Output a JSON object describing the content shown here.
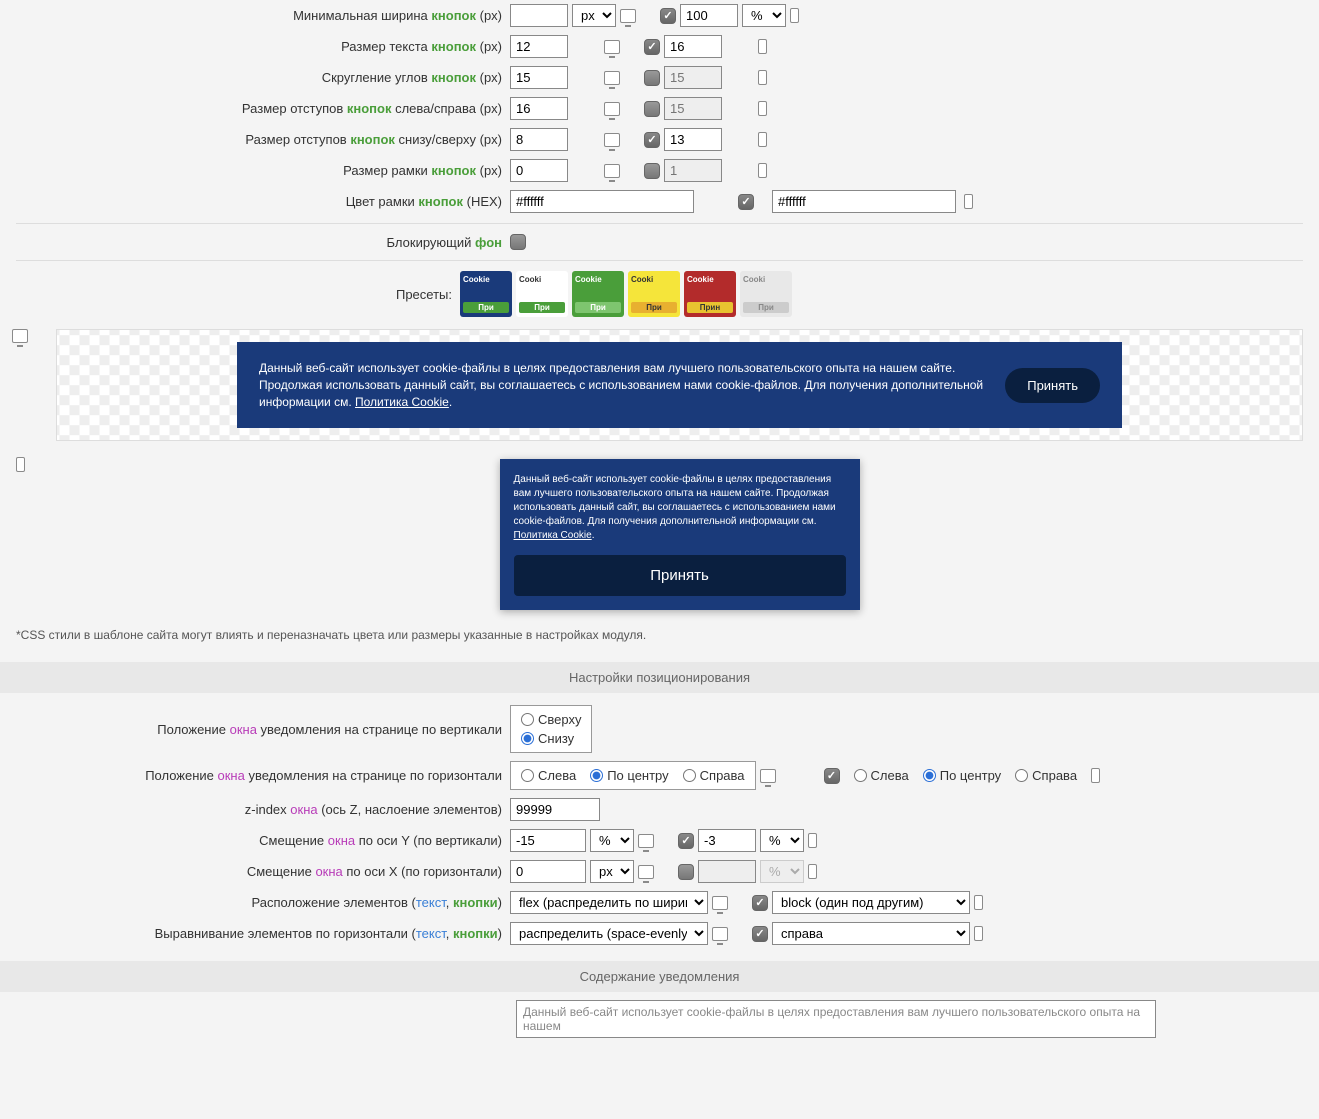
{
  "rows": {
    "min_width": {
      "label_pre": "Минимальная ширина ",
      "kw": "кнопок",
      "label_post": " (px)",
      "d_val": "",
      "d_unit": "px",
      "m_checked": true,
      "m_val": "100",
      "m_unit": "%"
    },
    "text_size": {
      "label_pre": "Размер текста ",
      "kw": "кнопок",
      "label_post": " (px)",
      "d_val": "12",
      "m_checked": true,
      "m_val": "16"
    },
    "border_radius": {
      "label_pre": "Скругление углов ",
      "kw": "кнопок",
      "label_post": " (px)",
      "d_val": "15",
      "m_checked": false,
      "m_placeholder": "15"
    },
    "pad_lr": {
      "label_pre": "Размер отступов ",
      "kw": "кнопок",
      "label_post": " слева/справа (px)",
      "d_val": "16",
      "m_checked": false,
      "m_placeholder": "15"
    },
    "pad_tb": {
      "label_pre": "Размер отступов ",
      "kw": "кнопок",
      "label_post": " снизу/сверху (px)",
      "d_val": "8",
      "m_checked": true,
      "m_val": "13"
    },
    "border_size": {
      "label_pre": "Размер рамки ",
      "kw": "кнопок",
      "label_post": " (px)",
      "d_val": "0",
      "m_checked": false,
      "m_placeholder": "1"
    },
    "border_color": {
      "label_pre": "Цвет рамки ",
      "kw": "кнопок",
      "label_post": " (HEX)",
      "d_val": "#ffffff",
      "m_checked": true,
      "m_val": "#ffffff"
    },
    "blocking_bg": {
      "label": "Блокирующий ",
      "kw": "фон",
      "checked": false
    }
  },
  "presets": {
    "label": "Пресеты:",
    "items": [
      {
        "bg": "#1a3a7a",
        "txt": "#fff",
        "btn_bg": "#4a9e3a",
        "btn_txt": "#fff",
        "cookie": "Cookie",
        "accept": "При"
      },
      {
        "bg": "#fff",
        "txt": "#333",
        "btn_bg": "#4a9e3a",
        "btn_txt": "#fff",
        "cookie": "Cooki",
        "accept": "При"
      },
      {
        "bg": "#4a9e3a",
        "txt": "#fff",
        "btn_bg": "#7ec56f",
        "btn_txt": "#fff",
        "cookie": "Cookie",
        "accept": "При"
      },
      {
        "bg": "#f5e53a",
        "txt": "#333",
        "btn_bg": "#e8b030",
        "btn_txt": "#333",
        "cookie": "Cooki",
        "accept": "При"
      },
      {
        "bg": "#b32b2b",
        "txt": "#fff",
        "btn_bg": "#e8c230",
        "btn_txt": "#333",
        "cookie": "Cookie",
        "accept": "Прин"
      },
      {
        "bg": "#e8e8e8",
        "txt": "#888",
        "btn_bg": "#ccc",
        "btn_txt": "#888",
        "cookie": "Cooki",
        "accept": "При"
      }
    ]
  },
  "preview": {
    "text": "Данный веб-сайт использует cookie-файлы в целях предоставления вам лучшего пользовательского опыта на нашем сайте. Продолжая использовать данный сайт, вы соглашаетесь с использованием нами cookie-файлов. Для получения дополнительной информации см. ",
    "link": "Политика Cookie",
    "accept": "Принять"
  },
  "note": "*CSS стили в шаблоне сайта могут влиять и переназначать цвета или размеры указанные в настройках модуля.",
  "positioning": {
    "header": "Настройки позиционирования",
    "pos_v": {
      "label_pre": "Положение ",
      "kw": "окна",
      "label_post": " уведомления на странице по вертикали",
      "opt1": "Сверху",
      "opt2": "Снизу",
      "selected": "Снизу"
    },
    "pos_h": {
      "label_pre": "Положение ",
      "kw": "окна",
      "label_post": " уведомления на странице по горизонтали",
      "opt1": "Слева",
      "opt2": "По центру",
      "opt3": "Справа",
      "d_selected": "По центру",
      "m_checked": true,
      "m_selected": "По центру"
    },
    "zindex": {
      "label_pre": "z-index ",
      "kw": "окна",
      "label_post": " (ось Z, наслоение элементов)",
      "val": "99999"
    },
    "offset_y": {
      "label_pre": "Смещение ",
      "kw": "окна",
      "label_post": " по оси Y (по вертикали)",
      "d_val": "-15",
      "d_unit": "%",
      "m_checked": true,
      "m_val": "-3",
      "m_unit": "%"
    },
    "offset_x": {
      "label_pre": "Смещение ",
      "kw": "окна",
      "label_post": " по оси X (по горизонтали)",
      "d_val": "0",
      "d_unit": "px",
      "m_checked": false,
      "m_unit": "%"
    },
    "layout": {
      "label_pre": "Расположение элементов (",
      "kw1": "текст",
      "sep": ", ",
      "kw2": "кнопки",
      "label_post": ")",
      "d_val": "flex (распределить по ширине)",
      "m_checked": true,
      "m_val": "block (один под другим)"
    },
    "align": {
      "label_pre": "Выравнивание элементов по горизонтали (",
      "kw1": "текст",
      "sep": ", ",
      "kw2": "кнопки",
      "label_post": ")",
      "d_val": "распределить (space-evenly)",
      "m_checked": true,
      "m_val": "справа"
    }
  },
  "content": {
    "header": "Содержание уведомления",
    "textarea_val": "Данный веб-сайт использует cookie-файлы в целях предоставления вам лучшего пользовательского опыта на нашем"
  }
}
